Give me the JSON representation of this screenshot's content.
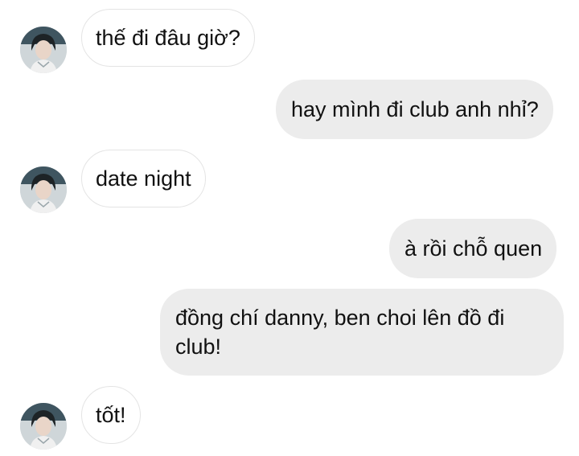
{
  "conversation": {
    "messages": [
      {
        "sender": "them",
        "text": "thế đi đâu giờ?",
        "avatar_icon": "user-avatar-icon"
      },
      {
        "sender": "me",
        "text": "hay mình đi club anh nhỉ?"
      },
      {
        "sender": "them",
        "text": "date night",
        "avatar_icon": "user-avatar-icon"
      },
      {
        "sender": "me",
        "text": "à rồi chỗ quen"
      },
      {
        "sender": "me",
        "text": "đồng chí danny, ben choi lên đồ đi club!"
      },
      {
        "sender": "them",
        "text": "tốt!",
        "avatar_icon": "user-avatar-icon"
      }
    ]
  },
  "colors": {
    "incoming_bubble": "#ffffff",
    "incoming_border": "#e4e4e4",
    "outgoing_bubble": "#ececec",
    "text": "#111111"
  }
}
